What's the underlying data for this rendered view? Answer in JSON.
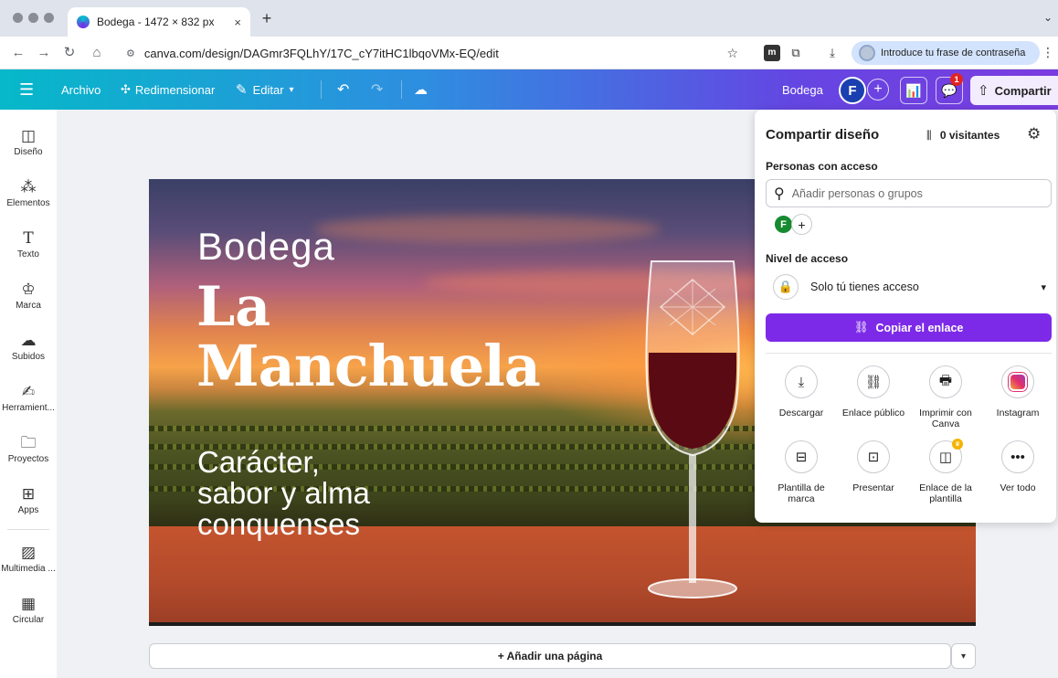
{
  "browser": {
    "tab_title": "Bodega - 1472 × 832 px",
    "tab_close": "×",
    "new_tab": "+",
    "url": "canva.com/design/DAGmr3FQLhY/17C_cY7itHC1lbqoVMx-EQ/edit",
    "profile_prompt": "Introduce tu frase de contraseña"
  },
  "toolbar": {
    "file_label": "Archivo",
    "resize_label": "Redimensionar",
    "edit_label": "Editar",
    "design_name": "Bodega",
    "user_initial": "F",
    "notification_count": "1",
    "share_label": "Compartir"
  },
  "sidebar": {
    "items": [
      {
        "label": "Diseño",
        "icon": "layout-icon"
      },
      {
        "label": "Elementos",
        "icon": "elements-icon"
      },
      {
        "label": "Texto",
        "icon": "text-icon"
      },
      {
        "label": "Marca",
        "icon": "brand-icon"
      },
      {
        "label": "Subidos",
        "icon": "upload-icon"
      },
      {
        "label": "Herramient...",
        "icon": "tools-icon"
      },
      {
        "label": "Proyectos",
        "icon": "folder-icon"
      },
      {
        "label": "Apps",
        "icon": "apps-icon"
      },
      {
        "label": "Multimedia ...",
        "icon": "media-icon"
      },
      {
        "label": "Circular",
        "icon": "circular-icon"
      }
    ]
  },
  "design": {
    "line1": "Bodega",
    "line2": "La",
    "line3": "Manchuela",
    "tagline1": "Carácter,",
    "tagline2": "sabor y alma",
    "tagline3": "conquenses"
  },
  "add_page_label": "+ Añadir una página",
  "share_panel": {
    "title": "Compartir diseño",
    "visitors": "0 visitantes",
    "people_label": "Personas con acceso",
    "search_placeholder": "Añadir personas o grupos",
    "member_initial": "F",
    "access_level_label": "Nivel de acceso",
    "access_value": "Solo tú tienes acceso",
    "copy_link": "Copiar el enlace",
    "options": [
      {
        "label": "Descargar",
        "icon": "download-icon"
      },
      {
        "label": "Enlace público",
        "icon": "link-icon"
      },
      {
        "label": "Imprimir con Canva",
        "icon": "print-icon"
      },
      {
        "label": "Instagram",
        "icon": "instagram-icon"
      },
      {
        "label": "Plantilla de marca",
        "icon": "brand-template-icon"
      },
      {
        "label": "Presentar",
        "icon": "present-icon"
      },
      {
        "label": "Enlace de la plantilla",
        "icon": "template-link-icon"
      },
      {
        "label": "Ver todo",
        "icon": "more-icon"
      }
    ]
  },
  "colors": {
    "accent": "#7d2ae8",
    "toolbar_start": "#06b8c9",
    "toolbar_end": "#7b3ce0"
  }
}
